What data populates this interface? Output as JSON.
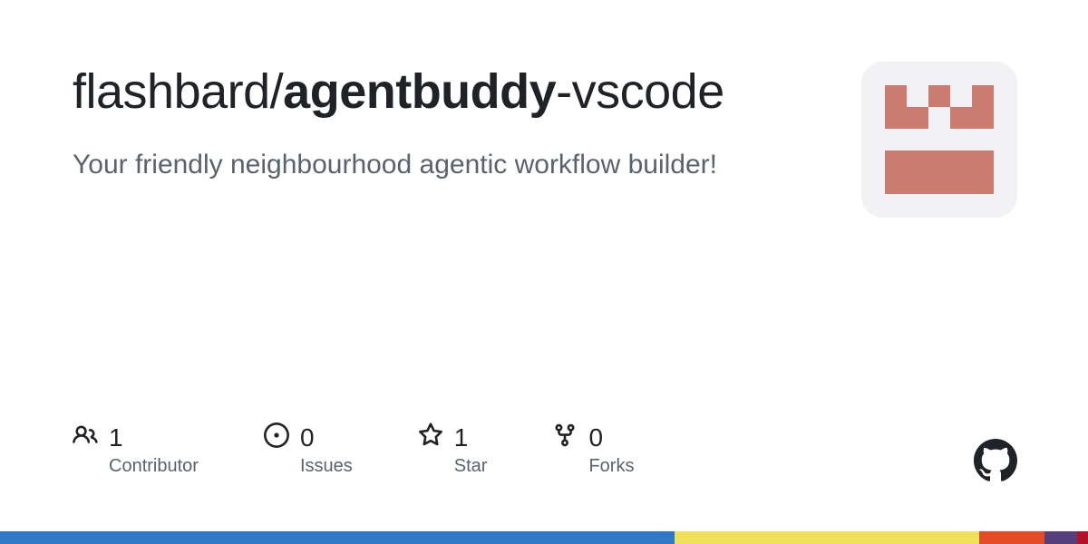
{
  "repo": {
    "owner": "flashbard",
    "slash": "/",
    "name_bold": "agentbuddy",
    "name_rest": "-vscode"
  },
  "description": "Your friendly neighbourhood agentic workflow builder!",
  "stats": {
    "contributors": {
      "count": "1",
      "label": "Contributor"
    },
    "issues": {
      "count": "0",
      "label": "Issues"
    },
    "stars": {
      "count": "1",
      "label": "Star"
    },
    "forks": {
      "count": "0",
      "label": "Forks"
    }
  },
  "language_bar": [
    {
      "color": "#3178c6",
      "percent": 62
    },
    {
      "color": "#f1e05a",
      "percent": 28
    },
    {
      "color": "#e34c26",
      "percent": 6
    },
    {
      "color": "#563d7c",
      "percent": 3
    },
    {
      "color": "#b5102a",
      "percent": 1
    }
  ]
}
